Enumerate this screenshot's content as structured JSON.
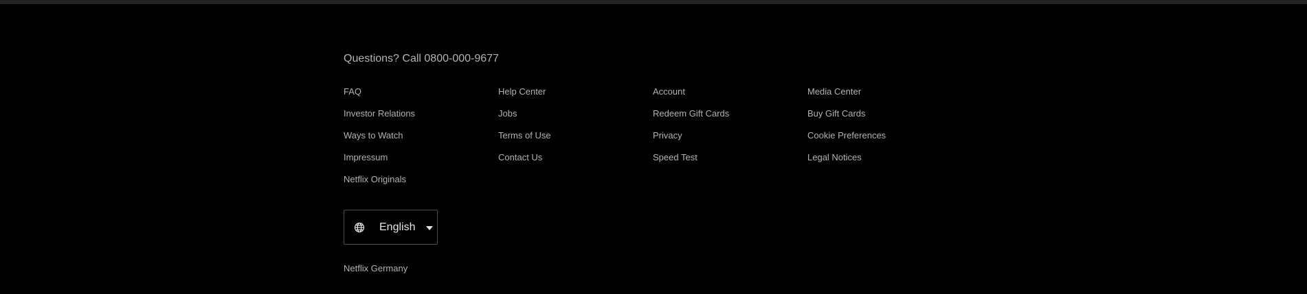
{
  "footer": {
    "questions": "Questions? Call 0800-000-9677",
    "links": [
      [
        "FAQ",
        "Investor Relations",
        "Ways to Watch",
        "Impressum",
        "Netflix Originals"
      ],
      [
        "Help Center",
        "Jobs",
        "Terms of Use",
        "Contact Us"
      ],
      [
        "Account",
        "Redeem Gift Cards",
        "Privacy",
        "Speed Test"
      ],
      [
        "Media Center",
        "Buy Gift Cards",
        "Cookie Preferences",
        "Legal Notices"
      ]
    ],
    "language": {
      "selected": "English",
      "icon": "globe-icon",
      "dropdown_icon": "caret-down-icon"
    },
    "country": "Netflix Germany"
  },
  "colors": {
    "background": "#000000",
    "divider": "#232323",
    "text": "#b3b3b3",
    "border": "#4d4d4d",
    "language_text": "#e5e5e5"
  }
}
